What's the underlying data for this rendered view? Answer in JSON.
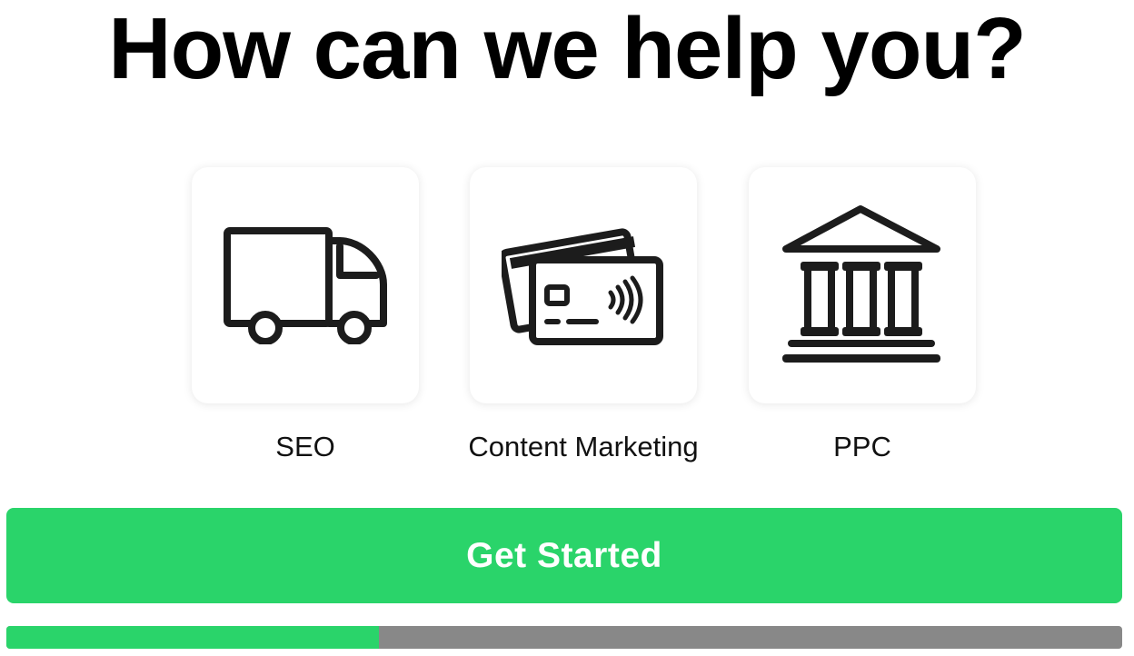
{
  "heading": "How can we help you?",
  "options": [
    {
      "label": "SEO",
      "icon": "truck-icon"
    },
    {
      "label": "Content Marketing",
      "icon": "credit-cards-icon"
    },
    {
      "label": "PPC",
      "icon": "bank-building-icon"
    }
  ],
  "cta": {
    "label": "Get Started"
  },
  "progress": {
    "fraction": 0.334
  },
  "colors": {
    "accent": "#2AD46A",
    "track": "#888888",
    "icon": "#1c1c1c"
  }
}
